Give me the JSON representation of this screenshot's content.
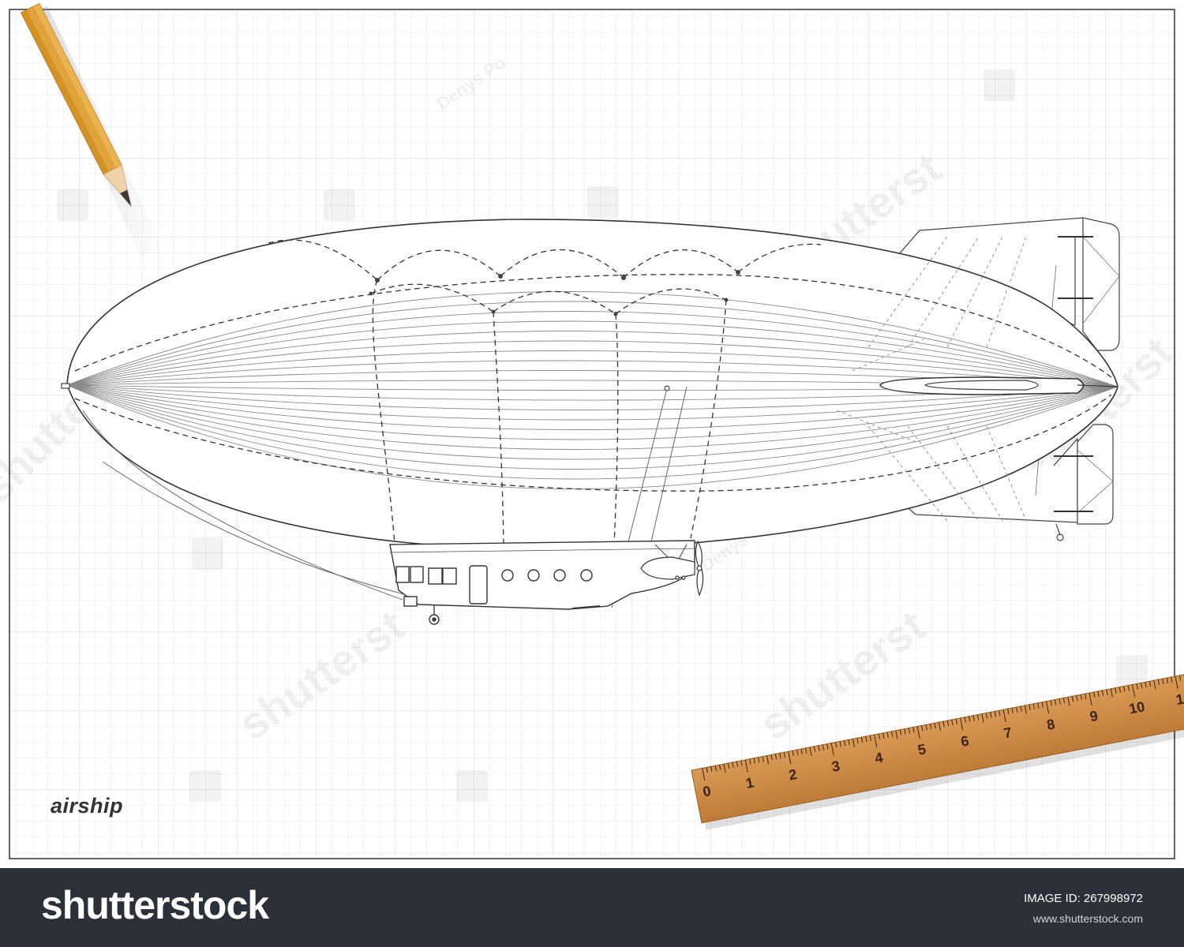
{
  "drawing": {
    "caption": "airship",
    "subject": "airship",
    "watermark_author": "Denys Po",
    "watermark_brand": "shutterstock"
  },
  "ruler": {
    "labels": [
      "0",
      "1",
      "2",
      "3",
      "4",
      "5",
      "6",
      "7",
      "8",
      "9",
      "10",
      "1"
    ]
  },
  "footer": {
    "brand": "shutterstock",
    "image_id_label": "IMAGE ID: 267998972",
    "site": "www.shutterstock.com"
  },
  "colors": {
    "footer_bg": "#2c3038",
    "grid_line": "#dfe3ea",
    "pencil_body": "#e0a23a",
    "ruler_body": "#cf8a45"
  }
}
